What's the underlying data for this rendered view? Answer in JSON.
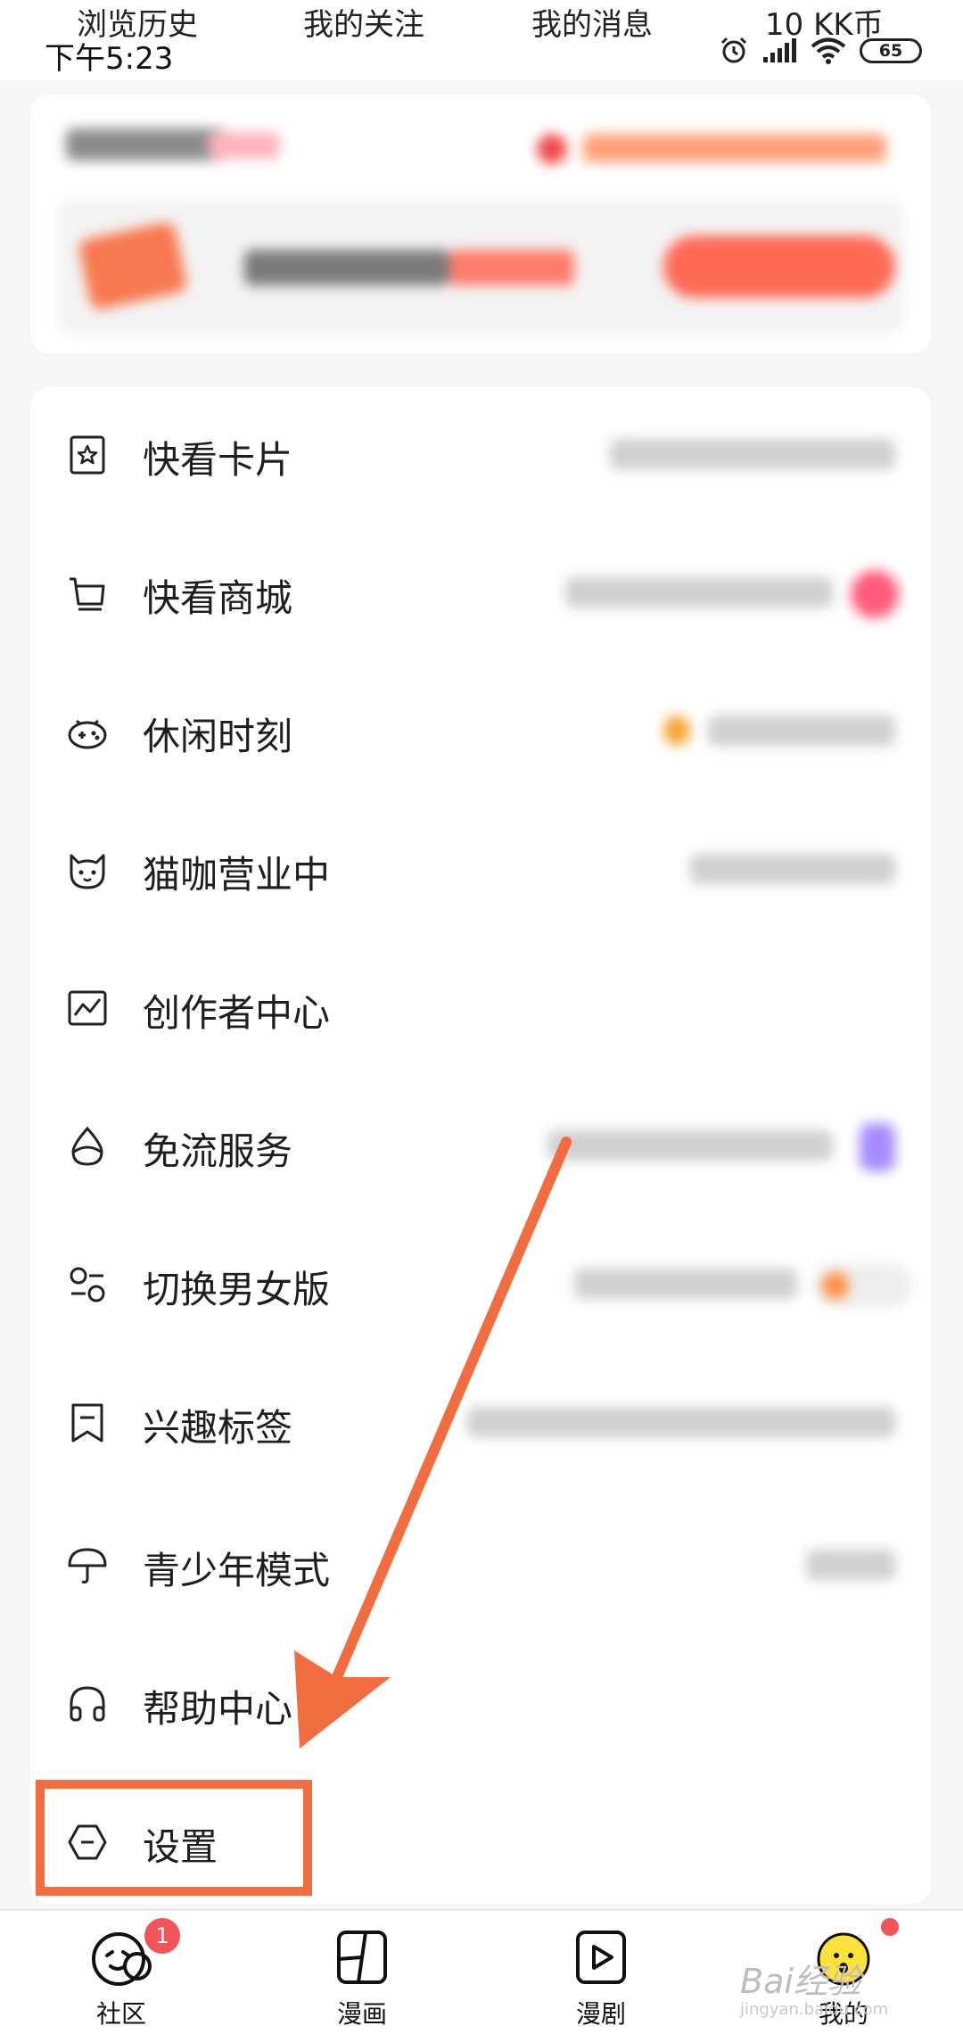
{
  "top_links": {
    "history": "浏览历史",
    "follows": "我的关注",
    "messages": "我的消息",
    "coins": "10 KK币"
  },
  "status_bar": {
    "time": "下午5:23",
    "battery": "65"
  },
  "menu": {
    "items": [
      {
        "label": "快看卡片",
        "icon": "card-star-icon"
      },
      {
        "label": "快看商城",
        "icon": "cart-icon"
      },
      {
        "label": "休闲时刻",
        "icon": "gamepad-icon"
      },
      {
        "label": "猫咖营业中",
        "icon": "cat-icon"
      },
      {
        "label": "创作者中心",
        "icon": "chart-icon"
      },
      {
        "label": "免流服务",
        "icon": "droplet-icon"
      },
      {
        "label": "切换男女版",
        "icon": "switch-icon"
      },
      {
        "label": "兴趣标签",
        "icon": "tag-icon"
      },
      {
        "label": "青少年模式",
        "icon": "umbrella-icon"
      },
      {
        "label": "帮助中心",
        "icon": "headphones-icon"
      },
      {
        "label": "设置",
        "icon": "settings-hexagon-icon"
      }
    ]
  },
  "bottom_nav": {
    "items": [
      {
        "label": "社区",
        "badge": "1",
        "icon": "community-face-icon"
      },
      {
        "label": "漫画",
        "icon": "comic-panel-icon"
      },
      {
        "label": "漫剧",
        "icon": "play-icon"
      },
      {
        "label": "我的",
        "icon": "avatar-icon"
      }
    ]
  },
  "colors": {
    "annotation": "#f16d3f",
    "badge": "#f2545b"
  },
  "watermark": {
    "main": "Bai经验",
    "sub": "jingyan.baidu.com"
  }
}
